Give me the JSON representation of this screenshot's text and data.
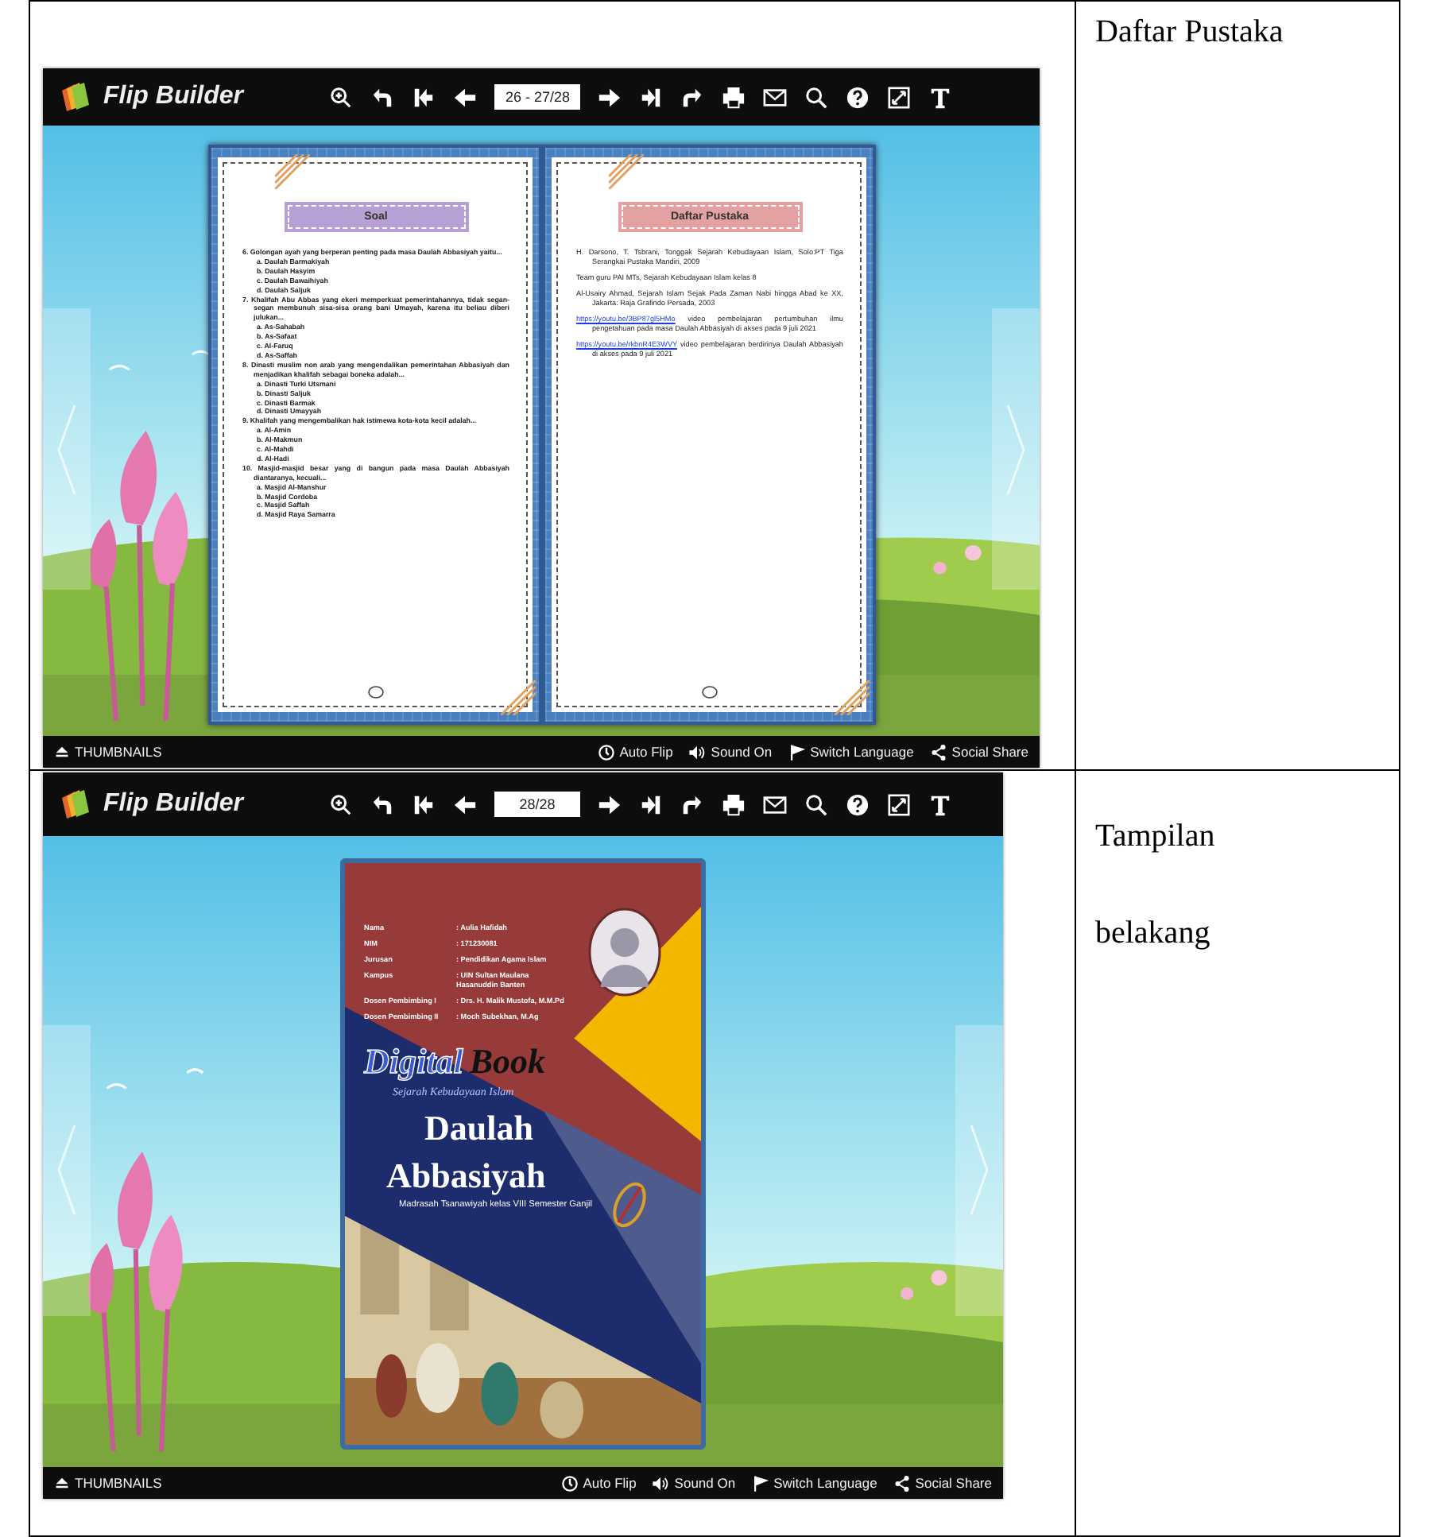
{
  "rows": [
    {
      "viewer": {
        "logo": "Flip Builder",
        "toolbar": {
          "page_field": "26 - 27/28"
        },
        "content": {
          "kind": "spread",
          "pages": [
            {
              "title": "Soal",
              "color": "#b7a1d4",
              "lines": [
                {
                  "kind": "question",
                  "text": "6. Golongan ayah yang berperan penting pada masa Daulah Abbasiyah yaitu..."
                },
                {
                  "kind": "option",
                  "text": "a. Daulah Barmakiyah"
                },
                {
                  "kind": "option",
                  "text": "b. Daulah Hasyim"
                },
                {
                  "kind": "option",
                  "text": "c. Daulah Bawaihiyah"
                },
                {
                  "kind": "option",
                  "text": "d. Daulah Saljuk"
                },
                {
                  "kind": "question",
                  "text": "7. Khalifah Abu Abbas yang ekeri memperkuat pemerintahannya, tidak segan-segan membunuh sisa-sisa orang bani Umayah, karena itu beliau diberi julukan..."
                },
                {
                  "kind": "option",
                  "text": "a. As-Sahabah"
                },
                {
                  "kind": "option",
                  "text": "b. As-Safaat"
                },
                {
                  "kind": "option",
                  "text": "c. Al-Faruq"
                },
                {
                  "kind": "option",
                  "text": "d. As-Saffah"
                },
                {
                  "kind": "question",
                  "text": "8. Dinasti muslim non arab yang mengendalikan pemerintahan Abbasiyah dan menjadikan khalifah sebagai boneka adalah..."
                },
                {
                  "kind": "option",
                  "text": "a. Dinasti Turki Utsmani"
                },
                {
                  "kind": "option",
                  "text": "b. Dinasti Saljuk"
                },
                {
                  "kind": "option",
                  "text": "c. Dinasti Barmak"
                },
                {
                  "kind": "option",
                  "text": "d. Dinasti Umayyah"
                },
                {
                  "kind": "question",
                  "text": "9. Khalifah yang mengembalikan hak istimewa kota-kota kecil adalah..."
                },
                {
                  "kind": "option",
                  "text": "a. Al-Amin"
                },
                {
                  "kind": "option",
                  "text": "b. Al-Makmun"
                },
                {
                  "kind": "option",
                  "text": "c. Al-Mahdi"
                },
                {
                  "kind": "option",
                  "text": "d. Al-Hadi"
                },
                {
                  "kind": "question",
                  "text": "10. Masjid-masjid besar yang di bangun pada masa Daulah Abbasiyah diantaranya, kecuali..."
                },
                {
                  "kind": "option",
                  "text": "a. Masjid Al-Manshur"
                },
                {
                  "kind": "option",
                  "text": "b. Masjid Cordoba"
                },
                {
                  "kind": "option",
                  "text": "c. Masjid Saffah"
                },
                {
                  "kind": "option",
                  "text": "d. Masjid Raya Samarra"
                }
              ]
            },
            {
              "title": "Daftar Pustaka",
              "color": "#e3a1a1",
              "lines": [
                {
                  "kind": "reference",
                  "text": "H. Darsono, T. Tsbrani, Tonggak Sejarah Kebudayaan Islam, Solo:PT Tiga Serangkai Pustaka Mandiri, 2009"
                },
                {
                  "kind": "reference",
                  "text": "Team guru PAI MTs, Sejarah Kebudayaan Islam kelas 8"
                },
                {
                  "kind": "reference",
                  "text": "Al-Usairy Ahmad, Sejarah Islam Sejak Pada Zaman Nabi hingga Abad ke XX, Jakarta: Raja Grafindo Persada, 2003"
                },
                {
                  "kind": "link-reference",
                  "link": "https://youtu.be/3BP87gl5HMo",
                  "text": "video pembelajaran pertumbuhan ilmu pengetahuan pada masa Daulah Abbasiyah di akses pada 9 juli 2021"
                },
                {
                  "kind": "link-reference",
                  "link": "https://youtu.be/rkbnR4E3WVY",
                  "text": "video pembelajaran berdirinya Daulah Abbasiyah di akses pada 9 juli 2021"
                }
              ]
            }
          ]
        },
        "bottom_bar": {
          "thumbnails": "THUMBNAILS",
          "items": [
            "Auto Flip",
            "Sound On",
            "Switch Language",
            "Social Share"
          ]
        }
      },
      "caption": [
        "Daftar Pustaka"
      ]
    },
    {
      "viewer": {
        "logo": "Flip Builder",
        "toolbar": {
          "page_field": "28/28"
        },
        "content": {
          "kind": "cover",
          "info": [
            {
              "label": "Nama",
              "value": ": Aulia Hafidah"
            },
            {
              "label": "NIM",
              "value": ": 171230081"
            },
            {
              "label": "Jurusan",
              "value": ": Pendidikan Agama Islam"
            },
            {
              "label": "Kampus",
              "value": ": UIN Sultan Maulana Hasanuddin Banten"
            },
            {
              "label": "Dosen Pembimbing I",
              "value": ": Drs. H. Malik Mustofa, M.M.Pd"
            },
            {
              "label": "Dosen Pembimbing II",
              "value": ": Moch Subekhan, M.Ag"
            }
          ],
          "brand_first": "Digital",
          "brand_second": "Book",
          "subject": "Sejarah Kebudayaan Islam",
          "title_lines": [
            "Daulah",
            "Abbasiyah"
          ],
          "subtitle": "Madrasah Tsanawiyah kelas VIII Semester Ganjil"
        },
        "bottom_bar": {
          "thumbnails": "THUMBNAILS",
          "items": [
            "Auto Flip",
            "Sound On",
            "Switch Language",
            "Social Share"
          ]
        }
      },
      "caption": [
        "Tampilan",
        "belakang"
      ]
    }
  ]
}
